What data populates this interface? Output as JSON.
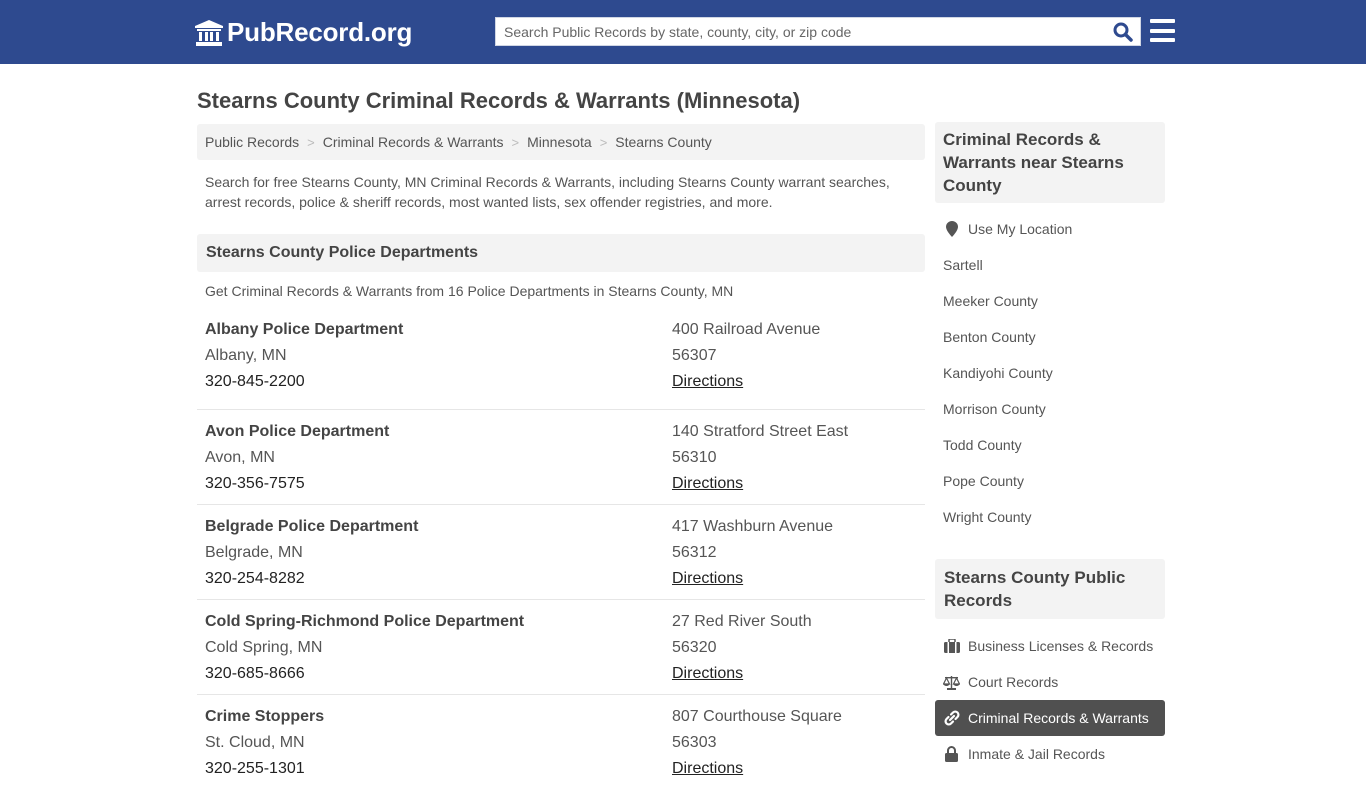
{
  "header": {
    "logo_text": "PubRecord.org",
    "search_placeholder": "Search Public Records by state, county, city, or zip code"
  },
  "colors": {
    "header_bg": "#2e4a8f",
    "search_icon": "#2e4a8f",
    "active_item_bg": "#505050"
  },
  "page": {
    "title": "Stearns County Criminal Records & Warrants (Minnesota)"
  },
  "breadcrumb": [
    {
      "label": "Public Records"
    },
    {
      "label": "Criminal Records & Warrants"
    },
    {
      "label": "Minnesota"
    },
    {
      "label": "Stearns County"
    }
  ],
  "intro": "Search for free Stearns County, MN Criminal Records & Warrants, including Stearns County warrant searches, arrest records, police & sheriff records, most wanted lists, sex offender registries, and more.",
  "section": {
    "title": "Stearns County Police Departments",
    "subtitle": "Get Criminal Records & Warrants from 16 Police Departments in Stearns County, MN"
  },
  "departments": [
    {
      "name": "Albany Police Department",
      "city": "Albany, MN",
      "phone": "320-845-2200",
      "address": "400 Railroad Avenue",
      "zip": "56307",
      "directions": "Directions"
    },
    {
      "name": "Avon Police Department",
      "city": "Avon, MN",
      "phone": "320-356-7575",
      "address": "140 Stratford Street East",
      "zip": "56310",
      "directions": "Directions"
    },
    {
      "name": "Belgrade Police Department",
      "city": "Belgrade, MN",
      "phone": "320-254-8282",
      "address": "417 Washburn Avenue",
      "zip": "56312",
      "directions": "Directions"
    },
    {
      "name": "Cold Spring-Richmond Police Department",
      "city": "Cold Spring, MN",
      "phone": "320-685-8666",
      "address": "27 Red River South",
      "zip": "56320",
      "directions": "Directions"
    },
    {
      "name": "Crime Stoppers",
      "city": "St. Cloud, MN",
      "phone": "320-255-1301",
      "address": "807 Courthouse Square",
      "zip": "56303",
      "directions": "Directions"
    }
  ],
  "sidebar": {
    "nearby_title": "Criminal Records & Warrants near Stearns County",
    "use_location": "Use My Location",
    "nearby": [
      {
        "label": "Sartell"
      },
      {
        "label": "Meeker County"
      },
      {
        "label": "Benton County"
      },
      {
        "label": "Kandiyohi County"
      },
      {
        "label": "Morrison County"
      },
      {
        "label": "Todd County"
      },
      {
        "label": "Pope County"
      },
      {
        "label": "Wright County"
      }
    ],
    "records_title": "Stearns County Public Records",
    "records": [
      {
        "label": "Business Licenses & Records",
        "icon": "briefcase-icon"
      },
      {
        "label": "Court Records",
        "icon": "scale-icon"
      },
      {
        "label": "Criminal Records & Warrants",
        "icon": "link-icon",
        "active": true
      },
      {
        "label": "Inmate & Jail Records",
        "icon": "lock-icon"
      }
    ]
  }
}
